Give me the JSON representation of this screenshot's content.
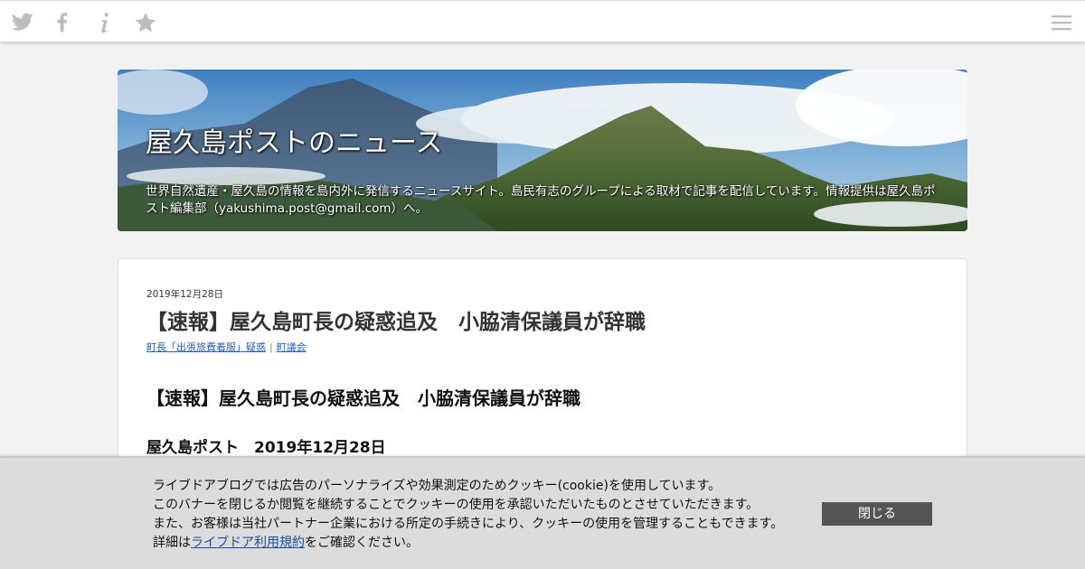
{
  "topbar": {
    "icons": [
      "twitter-icon",
      "facebook-icon",
      "info-icon",
      "star-icon",
      "menu-icon"
    ]
  },
  "header": {
    "title": "屋久島ポストのニュース",
    "description": "世界自然遺産・屋久島の情報を島内外に発信するニュースサイト。島民有志のグループによる取材で記事を配信しています。情報提供は屋久島ポスト編集部（yakushima.post@gmail.com）へ。"
  },
  "article": {
    "date": "2019年12月28日",
    "title": "【速報】屋久島町長の疑惑追及　小脇清保議員が辞職",
    "categories": [
      "町長「出張旅費着服」疑惑",
      "町議会"
    ],
    "heading": "【速報】屋久島町長の疑惑追及　小脇清保議員が辞職",
    "subheading": "屋久島ポスト　2019年12月28日"
  },
  "cookie": {
    "line1": "ライブドアブログでは広告のパーソナライズや効果測定のためクッキー(cookie)を使用しています。",
    "line2": "このバナーを閉じるか閲覧を継続することでクッキーの使用を承認いただいたものとさせていただきます。",
    "line3": "また、お客様は当社パートナー企業における所定の手続きにより、クッキーの使用を管理することもできます。",
    "line4_prefix": "詳細は",
    "line4_link": "ライブドア利用規約",
    "line4_suffix": "をご確認ください。",
    "close_label": "閉じる"
  },
  "colors": {
    "icon": "#bdbdbd",
    "link": "#2a5db0",
    "close_button": "#555555"
  }
}
